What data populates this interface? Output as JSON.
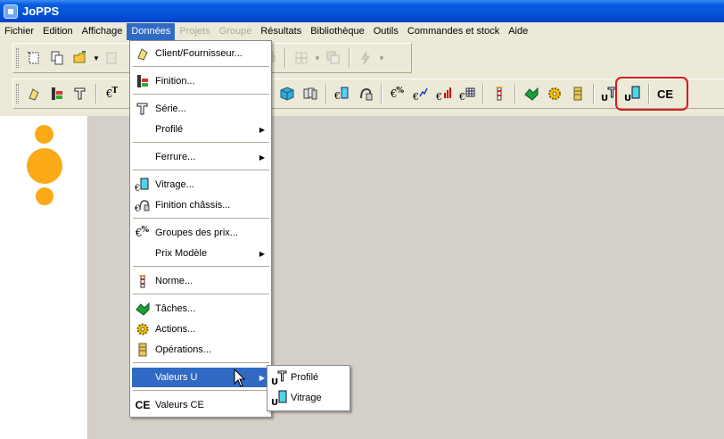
{
  "window": {
    "title": "JoPPS"
  },
  "menubar": {
    "items": [
      {
        "label": "Fichier",
        "state": "normal"
      },
      {
        "label": "Edition",
        "state": "normal"
      },
      {
        "label": "Affichage",
        "state": "normal"
      },
      {
        "label": "Données",
        "state": "active"
      },
      {
        "label": "Projets",
        "state": "disabled"
      },
      {
        "label": "Groupe",
        "state": "disabled"
      },
      {
        "label": "Résultats",
        "state": "normal"
      },
      {
        "label": "Bibliothèque",
        "state": "normal"
      },
      {
        "label": "Outils",
        "state": "normal"
      },
      {
        "label": "Commandes et stock",
        "state": "normal"
      },
      {
        "label": "Aide",
        "state": "normal"
      }
    ]
  },
  "toolbar2": {
    "ce_label": "CE"
  },
  "donnees_menu": {
    "items": [
      {
        "label": "Client/Fournisseur...",
        "icon": "client-icon"
      },
      {
        "label": "Finition...",
        "icon": "finition-icon"
      },
      {
        "label": "Série...",
        "icon": "serie-icon"
      },
      {
        "label": "Profilé",
        "icon": "",
        "submenu": true
      },
      {
        "label": "Ferrure...",
        "icon": "",
        "submenu": true
      },
      {
        "label": "Vitrage...",
        "icon": "vitrage-icon"
      },
      {
        "label": "Finition châssis...",
        "icon": "finition-chassis-icon"
      },
      {
        "label": "Groupes des prix...",
        "icon": "price-group-icon"
      },
      {
        "label": "Prix Modèle",
        "icon": "",
        "submenu": true
      },
      {
        "label": "Norme...",
        "icon": "norme-icon"
      },
      {
        "label": "Tâches...",
        "icon": "taches-icon"
      },
      {
        "label": "Actions...",
        "icon": "gear-icon"
      },
      {
        "label": "Opérations...",
        "icon": "operations-icon"
      },
      {
        "label": "Valeurs U",
        "icon": "",
        "submenu": true,
        "highlighted": true
      },
      {
        "label": "Valeurs CE",
        "icon": "ce-icon"
      }
    ]
  },
  "valeurs_u_submenu": {
    "items": [
      {
        "label": "Profilé",
        "icon": "u-profile-icon"
      },
      {
        "label": "Vitrage",
        "icon": "u-glass-icon"
      }
    ]
  },
  "colors": {
    "accent": "#316ac5",
    "titlebar": "#0a5ee0",
    "highlight_outline": "#d81a1a",
    "logo_dots": "#fca918"
  }
}
